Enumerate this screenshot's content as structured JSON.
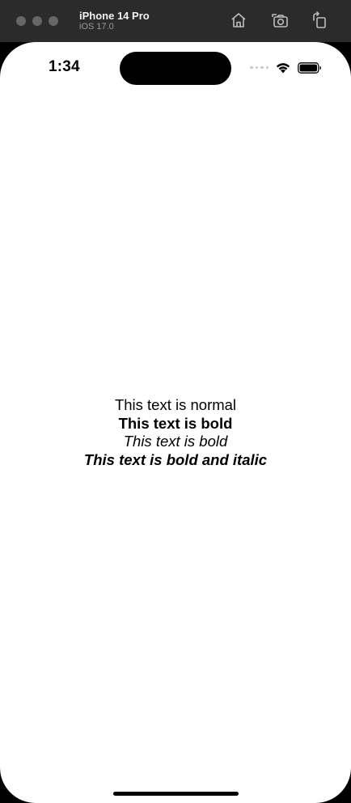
{
  "simulator": {
    "device_name": "iPhone 14 Pro",
    "os_version": "iOS 17.0",
    "toolbar_icons": [
      "home-icon",
      "screenshot-icon",
      "rotate-icon"
    ]
  },
  "status_bar": {
    "time": "1:34"
  },
  "content": {
    "line_normal": "This text is normal",
    "line_bold": "This text is bold",
    "line_italic": "This text is bold",
    "line_bold_italic": "This text is bold and italic"
  }
}
